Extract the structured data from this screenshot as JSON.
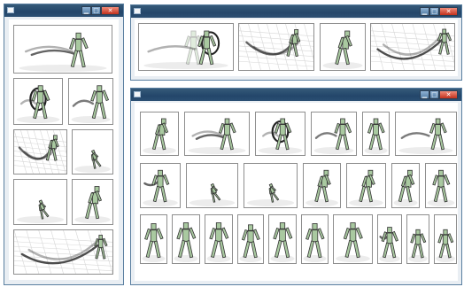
{
  "windows": [
    {
      "id": "left",
      "title": "",
      "icon": "app-window-icon",
      "controls": [
        "minimize-icon",
        "maximize-icon",
        "close-icon"
      ],
      "frames": [
        {
          "pose": "walk-trail-right"
        },
        {
          "pose": "loop-swirl"
        },
        {
          "pose": "walk-trail-left"
        },
        {
          "pose": "swirl-grid"
        },
        {
          "pose": "crouch"
        },
        {
          "pose": "crouch-small"
        },
        {
          "pose": "stand-bent"
        },
        {
          "pose": "curve-trail"
        }
      ]
    },
    {
      "id": "top-right",
      "title": "",
      "icon": "app-window-icon",
      "controls": [
        "minimize-icon",
        "maximize-icon",
        "close-icon"
      ],
      "frames": [
        {
          "pose": "double-walk"
        },
        {
          "pose": "swirl-grid"
        },
        {
          "pose": "stand-bent"
        },
        {
          "pose": "curve-trail"
        }
      ]
    },
    {
      "id": "bottom-right",
      "title": "",
      "icon": "app-window-icon",
      "controls": [
        "minimize-icon",
        "maximize-icon",
        "close-icon"
      ],
      "frames": [
        {
          "pose": "walk"
        },
        {
          "pose": "walk-trail-right"
        },
        {
          "pose": "loop-swirl"
        },
        {
          "pose": "walk-trail-left"
        },
        {
          "pose": "stand"
        },
        {
          "pose": "walk-trail-left"
        },
        {
          "pose": "stand-trail"
        },
        {
          "pose": "crouch"
        },
        {
          "pose": "crouch-small"
        },
        {
          "pose": "walk"
        },
        {
          "pose": "walk"
        },
        {
          "pose": "walk"
        },
        {
          "pose": "stand"
        },
        {
          "pose": "stand"
        },
        {
          "pose": "stand"
        },
        {
          "pose": "stand"
        },
        {
          "pose": "stand"
        },
        {
          "pose": "stand"
        },
        {
          "pose": "stand"
        },
        {
          "pose": "stand"
        },
        {
          "pose": "stand-trail"
        },
        {
          "pose": "stand"
        },
        {
          "pose": "stand"
        },
        {
          "pose": "stand"
        }
      ]
    }
  ],
  "colors": {
    "titlebar": "#2b4f73",
    "window_frame": "#e9eef3",
    "figure_fill": "#a9c9a0",
    "figure_outline": "#333333",
    "trail": "#222222",
    "close_button": "#c2311d"
  }
}
